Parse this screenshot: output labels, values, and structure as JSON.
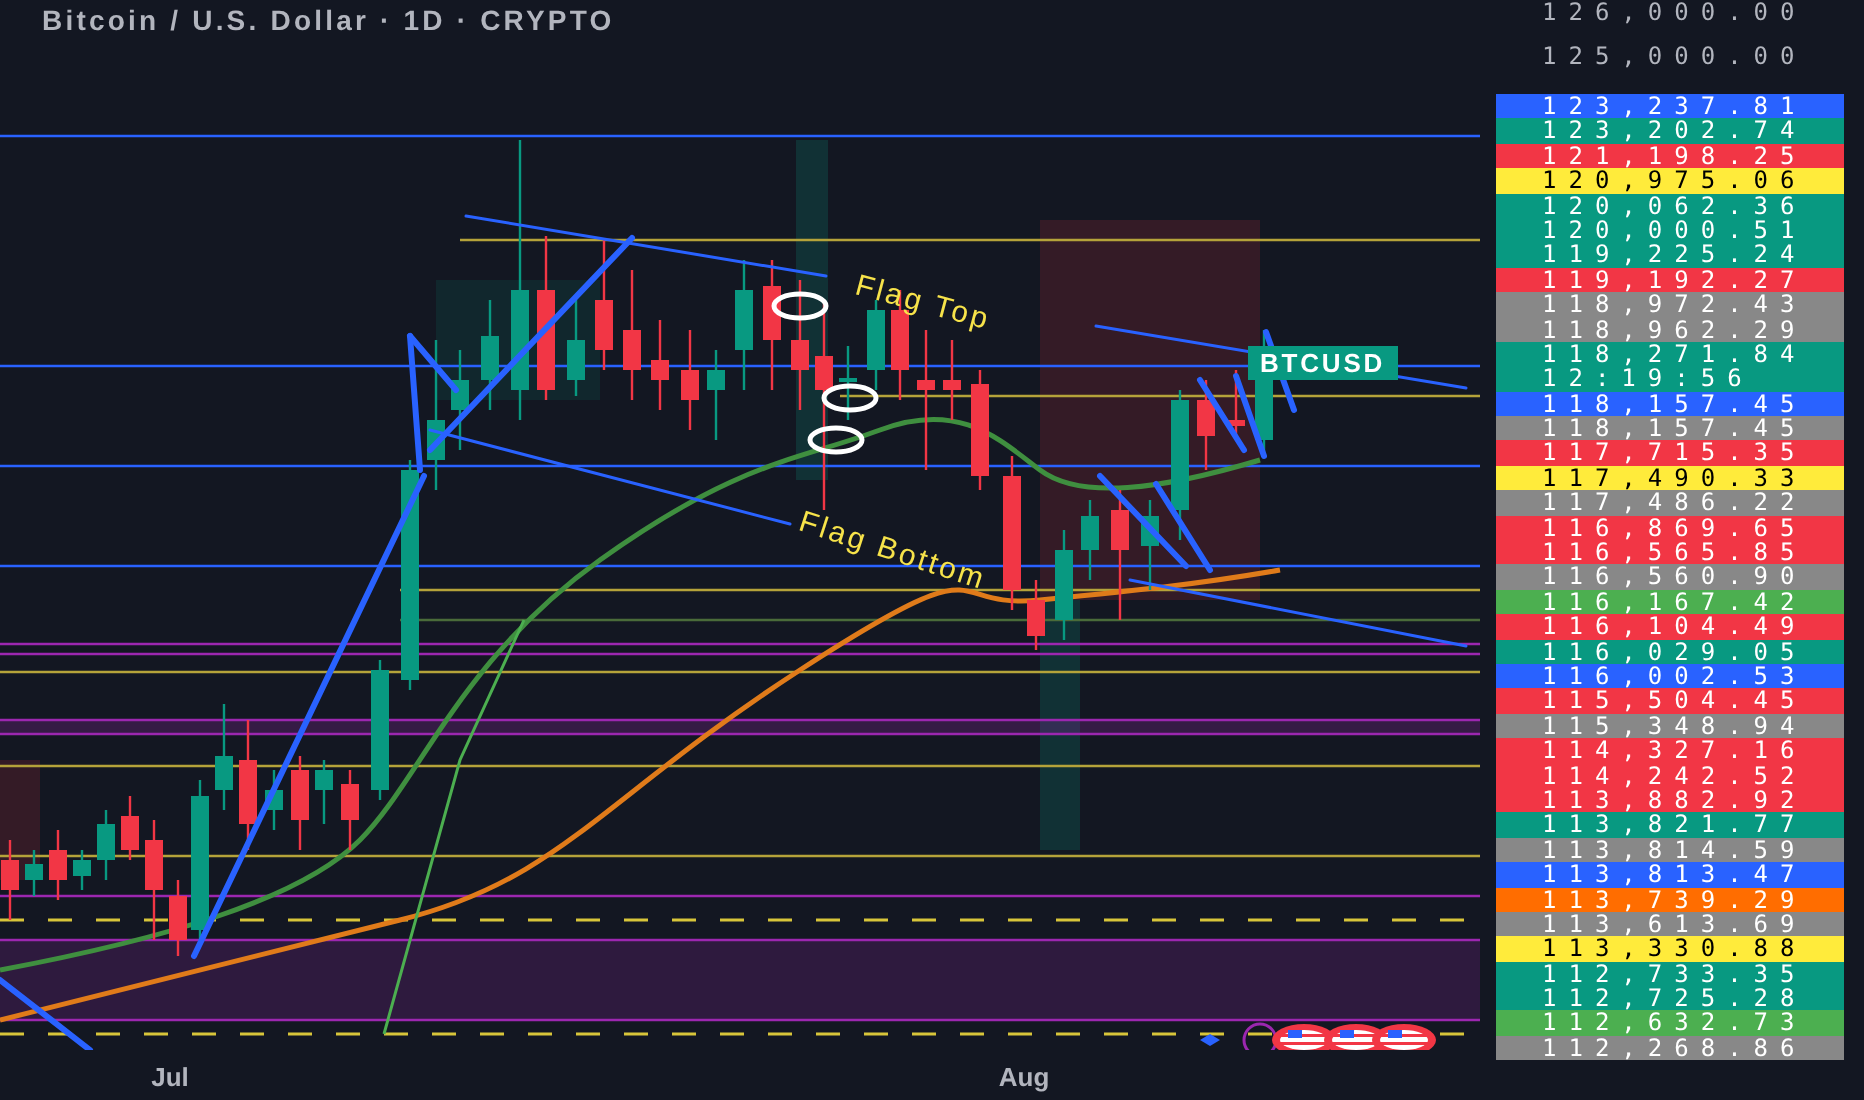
{
  "title": "Bitcoin / U.S. Dollar · 1D · CRYPTO",
  "annotations": [
    {
      "kind": "top",
      "text": "Flag Top"
    },
    {
      "kind": "bottom",
      "text": "Flag Bottom"
    }
  ],
  "symbol_label": "BTCUSD",
  "price_axis": {
    "ticks": [
      "126,000.00",
      "125,000.00"
    ]
  },
  "price_labels": [
    {
      "price": "123,237.81",
      "color": "#2962ff"
    },
    {
      "price": "123,202.74",
      "color": "#089981"
    },
    {
      "price": "121,198.25",
      "color": "#f23645"
    },
    {
      "price": "120,975.06",
      "color": "#ffeb3b"
    },
    {
      "price": "120,062.36",
      "color": "#089981"
    },
    {
      "price": "120,000.51",
      "color": "#089981"
    },
    {
      "price": "119,225.24",
      "color": "#089981"
    },
    {
      "price": "119,192.27",
      "color": "#f23645"
    },
    {
      "price": "118,972.43",
      "color": "#888888"
    },
    {
      "price": "118,962.29",
      "color": "#888888"
    },
    {
      "price": "118,271.84",
      "countdown": "12:19:56",
      "color": "#089981"
    },
    {
      "price": "118,157.45",
      "color": "#2962ff"
    },
    {
      "price": "118,157.45",
      "color": "#888888"
    },
    {
      "price": "117,715.35",
      "color": "#f23645"
    },
    {
      "price": "117,490.33",
      "color": "#ffeb3b"
    },
    {
      "price": "117,486.22",
      "color": "#888888"
    },
    {
      "price": "116,869.65",
      "color": "#f23645"
    },
    {
      "price": "116,565.85",
      "color": "#f23645"
    },
    {
      "price": "116,560.90",
      "color": "#888888"
    },
    {
      "price": "116,167.42",
      "color": "#4caf50"
    },
    {
      "price": "116,104.49",
      "color": "#f23645"
    },
    {
      "price": "116,029.05",
      "color": "#089981"
    },
    {
      "price": "116,002.53",
      "color": "#2962ff"
    },
    {
      "price": "115,504.45",
      "color": "#f23645"
    },
    {
      "price": "115,348.94",
      "color": "#888888"
    },
    {
      "price": "114,327.16",
      "color": "#f23645"
    },
    {
      "price": "114,242.52",
      "color": "#f23645"
    },
    {
      "price": "113,882.92",
      "color": "#f23645"
    },
    {
      "price": "113,821.77",
      "color": "#089981"
    },
    {
      "price": "113,814.59",
      "color": "#888888"
    },
    {
      "price": "113,813.47",
      "color": "#2962ff"
    },
    {
      "price": "113,739.29",
      "color": "#ff6d00"
    },
    {
      "price": "113,613.69",
      "color": "#888888"
    },
    {
      "price": "113,330.88",
      "color": "#ffeb3b"
    },
    {
      "price": "112,733.35",
      "color": "#089981"
    },
    {
      "price": "112,725.28",
      "color": "#089981"
    },
    {
      "price": "112,632.73",
      "color": "#4caf50"
    },
    {
      "price": "112,268.86",
      "color": "#888888"
    }
  ],
  "time_axis": [
    {
      "label": "Jul"
    },
    {
      "label": "Aug"
    }
  ]
}
